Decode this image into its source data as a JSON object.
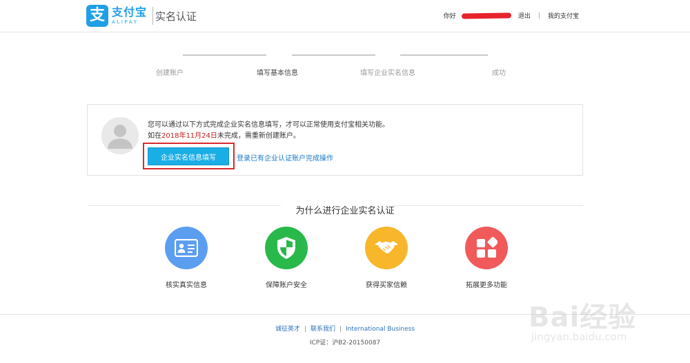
{
  "header": {
    "logo_mark": "支",
    "logo_cn": "支付宝",
    "logo_en": "ALIPAY",
    "title": "实名认证",
    "greeting": "你好",
    "logout": "退出",
    "my_alipay": "我的支付宝",
    "separator": "|"
  },
  "steps": [
    {
      "label": "创建账户",
      "active": false
    },
    {
      "label": "填写基本信息",
      "active": true
    },
    {
      "label": "填写企业实名信息",
      "active": false
    },
    {
      "label": "成功",
      "active": false
    }
  ],
  "card": {
    "line1": "您可以通过以下方式完成企业实名信息填写，才可以正常使用支付宝相关功能。",
    "line2_prefix": "如在",
    "line2_date": "2018年11月24日",
    "line2_suffix": "未完成，需重新创建账户。",
    "primary_button": "企业实名信息填写",
    "secondary_link": "登录已有企业认证账户完成操作"
  },
  "why": {
    "title": "为什么进行企业实名认证",
    "features": [
      {
        "label": "核实真实信息",
        "icon": "id-card-icon",
        "color": "#5b9ef0"
      },
      {
        "label": "保障账户安全",
        "icon": "shield-icon",
        "color": "#29b84a"
      },
      {
        "label": "获得买家信赖",
        "icon": "handshake-icon",
        "color": "#f8b62b"
      },
      {
        "label": "拓展更多功能",
        "icon": "grid-icon",
        "color": "#f05a5a"
      }
    ]
  },
  "footer": {
    "link1": "诚征英才",
    "link2": "联系我们",
    "link3": "International Business",
    "separator": "|",
    "icp": "ICP证：沪B2-20150087"
  },
  "watermark": {
    "text": "Bai经验",
    "url": "jingyan.baidu.com"
  },
  "colors": {
    "brand_blue": "#1f9fe6",
    "button_blue": "#1aaee6",
    "highlight_red": "#d9292f"
  }
}
